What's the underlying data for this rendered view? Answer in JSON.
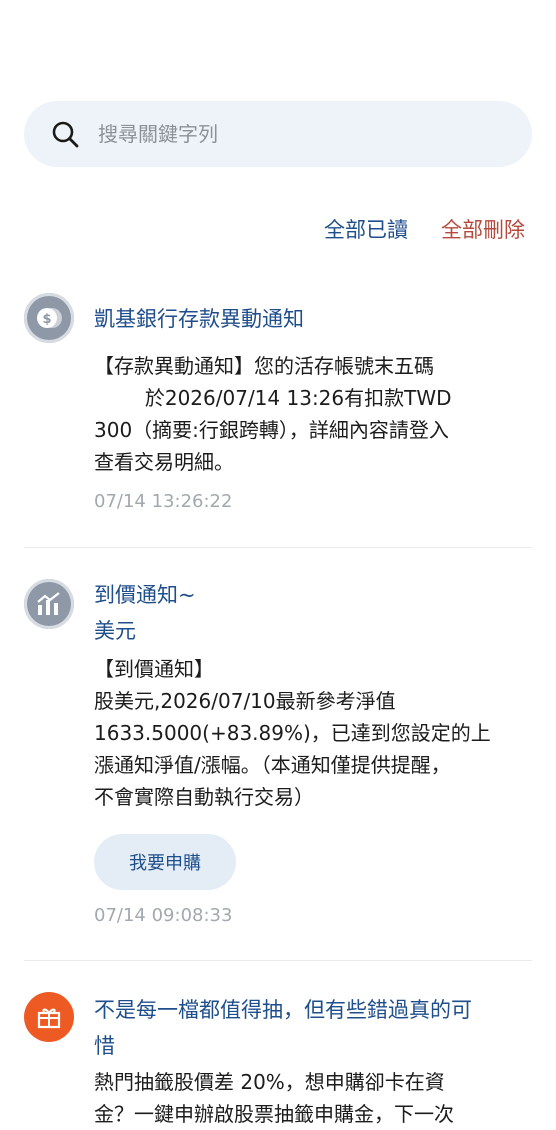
{
  "search": {
    "placeholder": "搜尋關鍵字列"
  },
  "actions": {
    "mark_all_read": "全部已讀",
    "delete_all": "全部刪除"
  },
  "notifications": [
    {
      "title": "凱基銀行存款異動通知",
      "lines": [
        "【存款異動通知】您的活存帳號末五碼",
        "        於2026/07/14 13:26有扣款TWD",
        "300（摘要:行銀跨轉），詳細內容請登入",
        "查看交易明細。"
      ],
      "timestamp": "07/14 13:26:22",
      "icon": "dollar-coin-icon"
    },
    {
      "title_lines": [
        "到價通知~",
        "美元"
      ],
      "lines": [
        "【到價通知】",
        "股美元,2026/07/10最新參考淨值",
        "1633.5000(+83.89%)，已達到您設定的上",
        "漲通知淨值/漲幅。（本通知僅提供提醒，",
        "不會實際自動執行交易）"
      ],
      "button": "我要申購",
      "timestamp": "07/14 09:08:33",
      "icon": "bar-chart-icon"
    },
    {
      "title_lines": [
        "不是每一檔都值得抽，但有些錯過真的可",
        "惜"
      ],
      "lines": [
        "熱門抽籤股價差 20%，想申購卻卡在資",
        "金？一鍵申辦啟股票抽籤申購金，下一次"
      ],
      "icon": "gift-icon",
      "accent": "#ee5a24"
    }
  ]
}
